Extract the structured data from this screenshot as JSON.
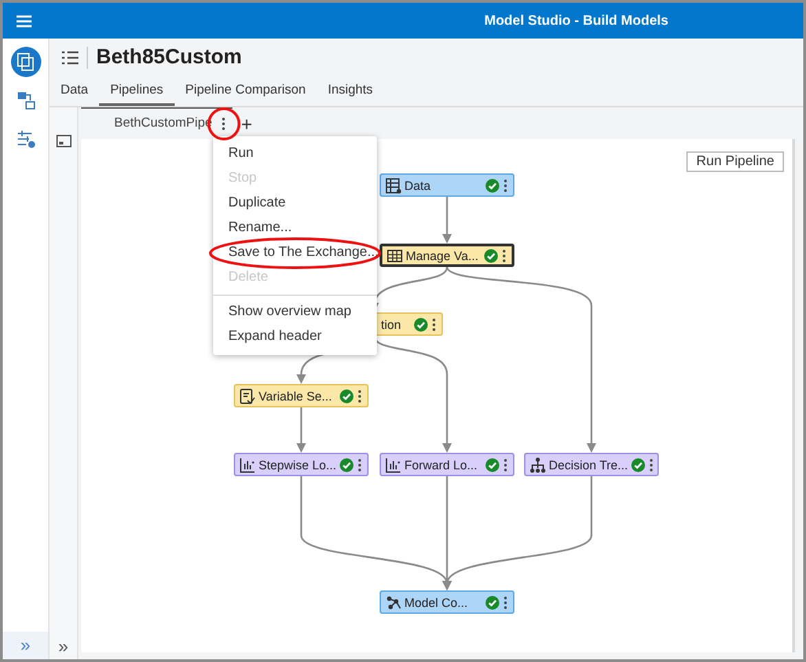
{
  "app_bar": {
    "title": "Model Studio - Build Models"
  },
  "nav_rail": {
    "items": [
      {
        "selected": true
      },
      {
        "selected": false
      },
      {
        "selected": false
      }
    ],
    "expand_label": "»"
  },
  "project": {
    "title": "Beth85Custom"
  },
  "tabs": [
    {
      "label": "Data",
      "selected": false
    },
    {
      "label": "Pipelines",
      "selected": true
    },
    {
      "label": "Pipeline Comparison",
      "selected": false
    },
    {
      "label": "Insights",
      "selected": false
    }
  ],
  "side_panel": {
    "expand_label": "»"
  },
  "pipeline_tabs": [
    {
      "label": "BethCustomPipe",
      "selected": true,
      "menu_circled": true
    }
  ],
  "add_label": "+",
  "run_button": "Run Pipeline",
  "nodes": [
    {
      "label": "Data",
      "kind": "data",
      "completed": true,
      "selected": false
    },
    {
      "label": "Manage Va...",
      "kind": "prep",
      "completed": true,
      "selected": true
    },
    {
      "label": "tion",
      "kind": "prep",
      "completed": true,
      "selected": false
    },
    {
      "label": "Variable Se...",
      "kind": "prep",
      "completed": true,
      "selected": false
    },
    {
      "label": "Stepwise Lo...",
      "kind": "model",
      "completed": true,
      "selected": false
    },
    {
      "label": "Forward Lo...",
      "kind": "model",
      "completed": true,
      "selected": false
    },
    {
      "label": "Decision Tre...",
      "kind": "model",
      "completed": true,
      "selected": false
    },
    {
      "label": "Model Co...",
      "kind": "data",
      "completed": true,
      "selected": false
    }
  ],
  "menu": {
    "groups": [
      [
        {
          "label": "Run",
          "disabled": false,
          "circled": false
        },
        {
          "label": "Stop",
          "disabled": true,
          "circled": false
        },
        {
          "label": "Duplicate",
          "disabled": false,
          "circled": false
        },
        {
          "label": "Rename...",
          "disabled": false,
          "circled": false
        },
        {
          "label": "Save to The Exchange...",
          "disabled": false,
          "circled": true
        },
        {
          "label": "Delete",
          "disabled": true,
          "circled": false
        }
      ],
      [
        {
          "label": "Show overview map",
          "disabled": false,
          "circled": false
        },
        {
          "label": "Expand header",
          "disabled": false,
          "circled": false
        }
      ]
    ]
  }
}
